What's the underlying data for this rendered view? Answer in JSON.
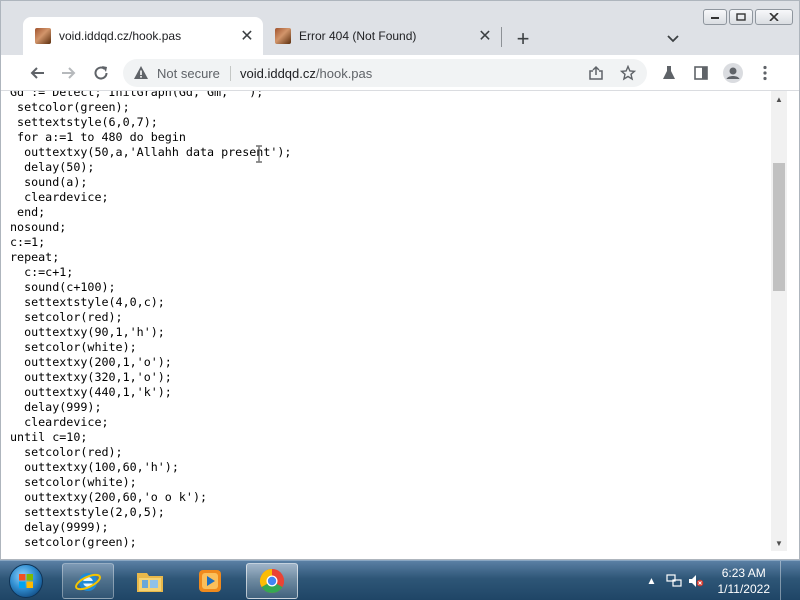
{
  "browser": {
    "tabs": [
      {
        "title": "void.iddqd.cz/hook.pas",
        "active": true,
        "favicon": "photo-favicon"
      },
      {
        "title": "Error 404 (Not Found)",
        "active": false,
        "favicon": "photo-favicon"
      }
    ],
    "security_label": "Not secure",
    "url_host": "void.iddqd.cz",
    "url_path": "/hook.pas"
  },
  "content": {
    "code_lines": [
      "Gd := Detect; InitGraph(Gd, Gm, '');",
      " setcolor(green);",
      " settextstyle(6,0,7);",
      " for a:=1 to 480 do begin",
      "  outtextxy(50,a,'Allahh data present');",
      "  delay(50);",
      "  sound(a);",
      "  cleardevice;",
      " end;",
      "nosound;",
      "c:=1;",
      "repeat;",
      "  c:=c+1;",
      "  sound(c+100);",
      "  settextstyle(4,0,c);",
      "  setcolor(red);",
      "  outtextxy(90,1,'h');",
      "  setcolor(white);",
      "  outtextxy(200,1,'o');",
      "  outtextxy(320,1,'o');",
      "  outtextxy(440,1,'k');",
      "  delay(999);",
      "  cleardevice;",
      "until c=10;",
      "  setcolor(red);",
      "  outtextxy(100,60,'h');",
      "  setcolor(white);",
      "  outtextxy(200,60,'o o k');",
      "  settextstyle(2,0,5);",
      "  delay(9999);",
      "  setcolor(green);"
    ]
  },
  "taskbar": {
    "apps": [
      "start-button",
      "internet-explorer",
      "windows-explorer",
      "windows-media-player",
      "google-chrome"
    ],
    "time": "6:23 AM",
    "date": "1/11/2022"
  },
  "colors": {
    "tabstrip": "#dee1e6",
    "omnibox": "#f1f3f4",
    "taskbar": "#2e5677"
  }
}
